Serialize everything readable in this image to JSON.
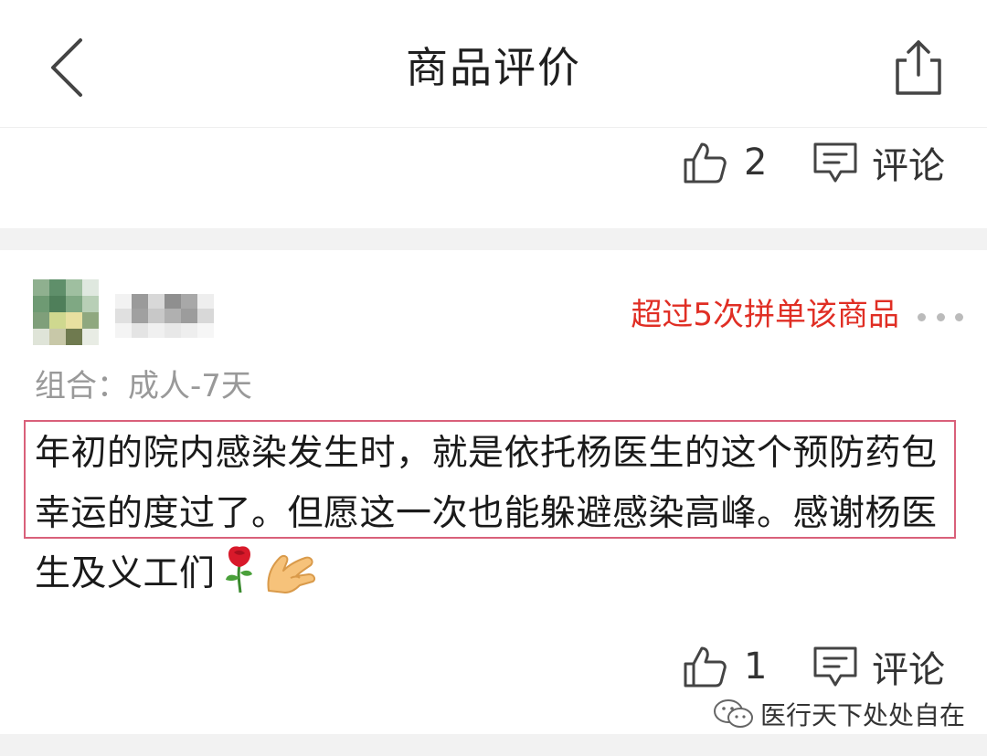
{
  "header": {
    "title": "商品评价",
    "back_icon": "chevron-left-icon",
    "share_icon": "share-icon"
  },
  "previous_review": {
    "like_count": "2",
    "comment_label": "评论"
  },
  "review": {
    "badge": "超过5次拼单该商品",
    "combo": "组合：成人-7天",
    "text": "年初的院内感染发生时，就是依托杨医生的这个预防药包幸运的度过了。但愿这一次也能躲避感染高峰。感谢杨医生及义工们",
    "emojis": [
      "rose-emoji",
      "pinched-hand-emoji"
    ],
    "like_count": "1",
    "comment_label": "评论"
  },
  "watermark": {
    "text": "医行天下处处自在",
    "icon": "wechat-icon"
  },
  "colors": {
    "accent_red": "#e02e24",
    "highlight_border": "#d9607a",
    "muted_text": "#999999",
    "divider": "#f2f2f2"
  }
}
